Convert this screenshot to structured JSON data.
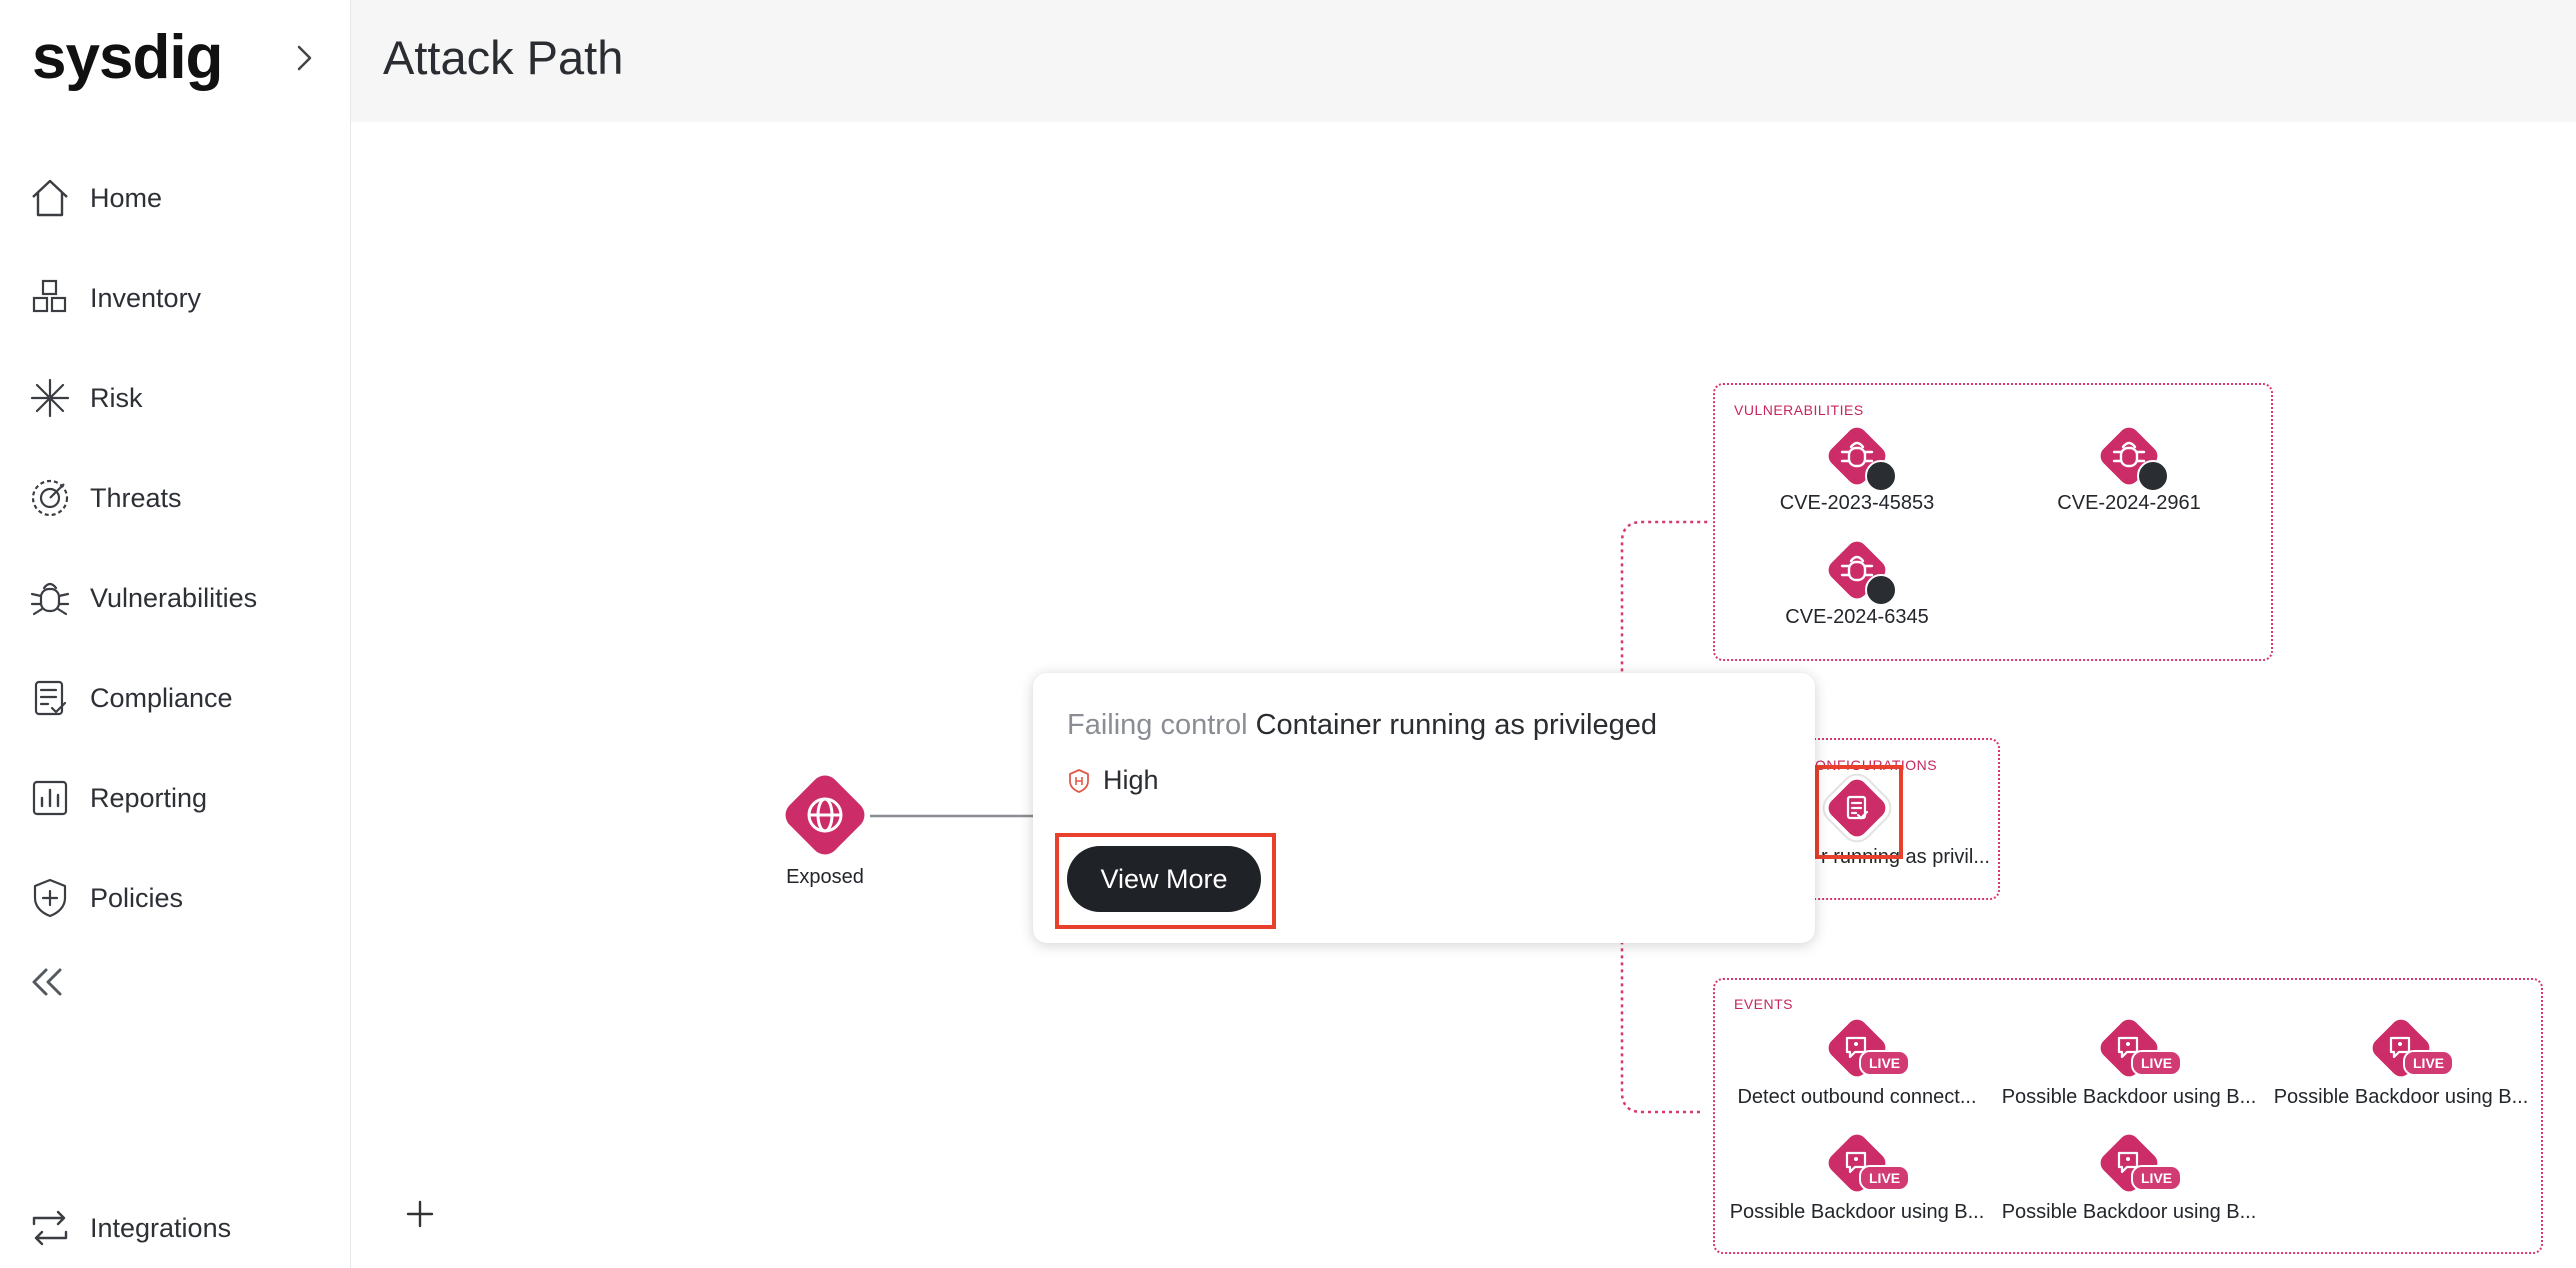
{
  "app": {
    "logo": "sysdig"
  },
  "header": {
    "title": "Attack Path"
  },
  "sidebar": {
    "items": [
      {
        "label": "Home",
        "icon": "home-icon"
      },
      {
        "label": "Inventory",
        "icon": "inventory-icon"
      },
      {
        "label": "Risk",
        "icon": "risk-icon"
      },
      {
        "label": "Threats",
        "icon": "threats-icon"
      },
      {
        "label": "Vulnerabilities",
        "icon": "bug-icon"
      },
      {
        "label": "Compliance",
        "icon": "compliance-icon"
      },
      {
        "label": "Reporting",
        "icon": "chart-icon"
      },
      {
        "label": "Policies",
        "icon": "shield-plus-icon"
      }
    ],
    "integrations_label": "Integrations"
  },
  "graph": {
    "source": {
      "label": "Exposed"
    },
    "vulnerabilities": {
      "title": "VULNERABILITIES",
      "items": [
        "CVE-2023-45853",
        "CVE-2024-2961",
        "CVE-2024-6345"
      ]
    },
    "misconfigurations": {
      "title": "ONFIGURATIONS",
      "item_label": "r running as privil..."
    },
    "events": {
      "title": "EVENTS",
      "badge": "LIVE",
      "items": [
        "Detect outbound connect...",
        "Possible Backdoor using B...",
        "Possible Backdoor using B...",
        "Possible Backdoor using B...",
        "Possible Backdoor using B..."
      ]
    }
  },
  "popover": {
    "kind": "Failing control",
    "name": "Container running as privileged",
    "severity": "High",
    "button_label": "View More"
  },
  "colors": {
    "accent": "#cc2d68",
    "highlight": "#e8402c",
    "dark": "#1f2226"
  }
}
